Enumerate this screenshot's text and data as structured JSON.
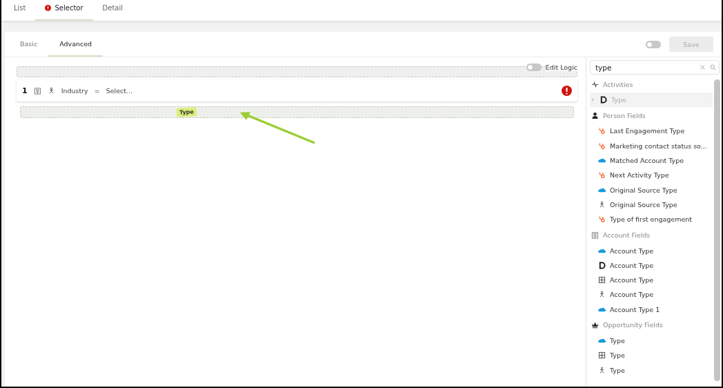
{
  "top_tabs": [
    {
      "label": "List",
      "selected": false,
      "error": false
    },
    {
      "label": "Selector",
      "selected": true,
      "error": true
    },
    {
      "label": "Detail",
      "selected": false,
      "error": false
    }
  ],
  "mode_tabs": [
    {
      "label": "Basic",
      "selected": false
    },
    {
      "label": "Advanced",
      "selected": true
    }
  ],
  "header_toggle": {
    "on": false
  },
  "save_button": {
    "label": "Save",
    "disabled": true
  },
  "edit_logic": {
    "label": "Edit Logic",
    "on": false
  },
  "conditions": [
    {
      "number": "1",
      "field": "Industry",
      "operator": "=",
      "value": "Select...",
      "error": true
    }
  ],
  "drop_zone": {
    "chip": "Type"
  },
  "search": {
    "value": "type"
  },
  "groups": [
    {
      "title": "Activities",
      "kind": "activity",
      "items": [
        {
          "label": "Type",
          "kind": "d",
          "dragging": true
        }
      ]
    },
    {
      "title": "Person Fields",
      "kind": "person",
      "items": [
        {
          "label": "Last Engagement Type",
          "kind": "hubspot",
          "dragging": false
        },
        {
          "label": "Marketing contact status so...",
          "kind": "hubspot",
          "dragging": false
        },
        {
          "label": "Matched Account Type",
          "kind": "salesforce",
          "dragging": false
        },
        {
          "label": "Next Activity Type",
          "kind": "hubspot",
          "dragging": false
        },
        {
          "label": "Original Source Type",
          "kind": "salesforce",
          "dragging": false
        },
        {
          "label": "Original Source Type",
          "kind": "person",
          "dragging": false
        },
        {
          "label": "Type of first engagement",
          "kind": "hubspot",
          "dragging": false
        }
      ]
    },
    {
      "title": "Account Fields",
      "kind": "building",
      "items": [
        {
          "label": "Account Type",
          "kind": "salesforce",
          "dragging": false
        },
        {
          "label": "Account Type",
          "kind": "d",
          "dragging": false
        },
        {
          "label": "Account Type",
          "kind": "grid",
          "dragging": false
        },
        {
          "label": "Account Type",
          "kind": "person",
          "dragging": false
        },
        {
          "label": "Account Type 1",
          "kind": "salesforce",
          "dragging": false
        }
      ]
    },
    {
      "title": "Opportunity Fields",
      "kind": "crown",
      "items": [
        {
          "label": "Type",
          "kind": "salesforce",
          "dragging": false
        },
        {
          "label": "Type",
          "kind": "grid",
          "dragging": false
        },
        {
          "label": "Type",
          "kind": "person",
          "dragging": false
        }
      ]
    }
  ]
}
